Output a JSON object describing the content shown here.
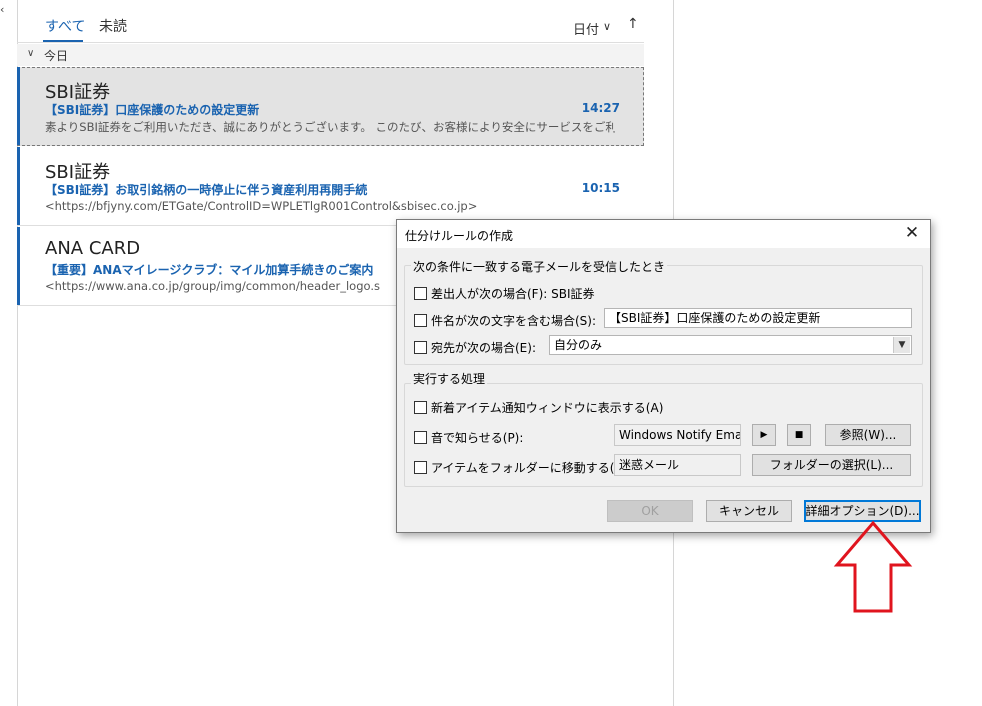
{
  "sidebar": {
    "collapse_glyph": "‹"
  },
  "filters": {
    "all": "すべて",
    "unread": "未読"
  },
  "sort": {
    "label": "日付",
    "chevron": "∨",
    "direction_arrow": "↑"
  },
  "group": {
    "label": "今日",
    "chevron": "∨"
  },
  "messages": [
    {
      "sender": "SBI証券",
      "subject": "【SBI証券】口座保護のための設定更新",
      "time": "14:27",
      "preview": "素よりSBI証券をご利用いただき、誠にありがとうございます。 このたび、お客様により安全にサービスをご利"
    },
    {
      "sender": "SBI証券",
      "subject": "【SBI証券】お取引銘柄の一時停止に伴う資産利用再開手続",
      "time": "10:15",
      "preview": "<https://bfjyny.com/ETGate/ControlID=WPLETlgR001Control&sbisec.co.jp>"
    },
    {
      "sender": "ANA CARD",
      "subject": "【重要】ANAマイレージクラブ：マイル加算手続きのご案内",
      "time": "",
      "preview": "<https://www.ana.co.jp/group/img/common/header_logo.s"
    }
  ],
  "dialog": {
    "title": "仕分けルールの作成",
    "close": "✕",
    "conditions_group": "次の条件に一致する電子メールを受信したとき",
    "from_label": "差出人が次の場合(F): SBI証券",
    "subject_label": "件名が次の文字を含む場合(S):",
    "subject_value": "【SBI証券】口座保護のための設定更新",
    "to_label": "宛先が次の場合(E):",
    "to_value": "自分のみ",
    "actions_group": "実行する処理",
    "notify_label": "新着アイテム通知ウィンドウに表示する(A)",
    "sound_label": "音で知らせる(P):",
    "sound_value": "Windows Notify Ema",
    "play_glyph": "▶",
    "stop_glyph": "■",
    "browse_label": "参照(W)...",
    "move_label": "アイテムをフォルダーに移動する(M):",
    "folder_value": "迷惑メール",
    "select_folder_label": "フォルダーの選択(L)...",
    "ok_label": "OK",
    "cancel_label": "キャンセル",
    "advanced_label": "詳細オプション(D)..."
  },
  "colors": {
    "accent": "#1a63b0",
    "annotation_arrow": "#e0141e"
  }
}
